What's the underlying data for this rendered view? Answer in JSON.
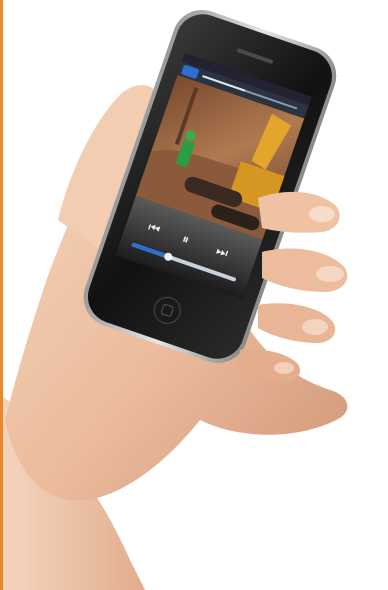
{
  "accent": "#e8892a",
  "screen": {
    "carrier": "",
    "top_button_label": "",
    "progress_fraction": 0.45,
    "controls": [
      {
        "name": "previous-track-icon",
        "glyph": "⏮"
      },
      {
        "name": "pause-icon",
        "glyph": "⏸"
      },
      {
        "name": "next-track-icon",
        "glyph": "⏭"
      }
    ],
    "volume_fraction": 0.35
  },
  "scene_colors": {
    "skin_light": "#f3cfb3",
    "skin_mid": "#e7b394",
    "skin_shadow": "#c98f70",
    "phone_body": "#151515",
    "phone_bezel": "#2e2e2e",
    "screen_dirt": "#a06a46",
    "excavator_yellow": "#e3a52b",
    "figure_green": "#31b34a",
    "blue_bar": "#2a6fd1"
  }
}
